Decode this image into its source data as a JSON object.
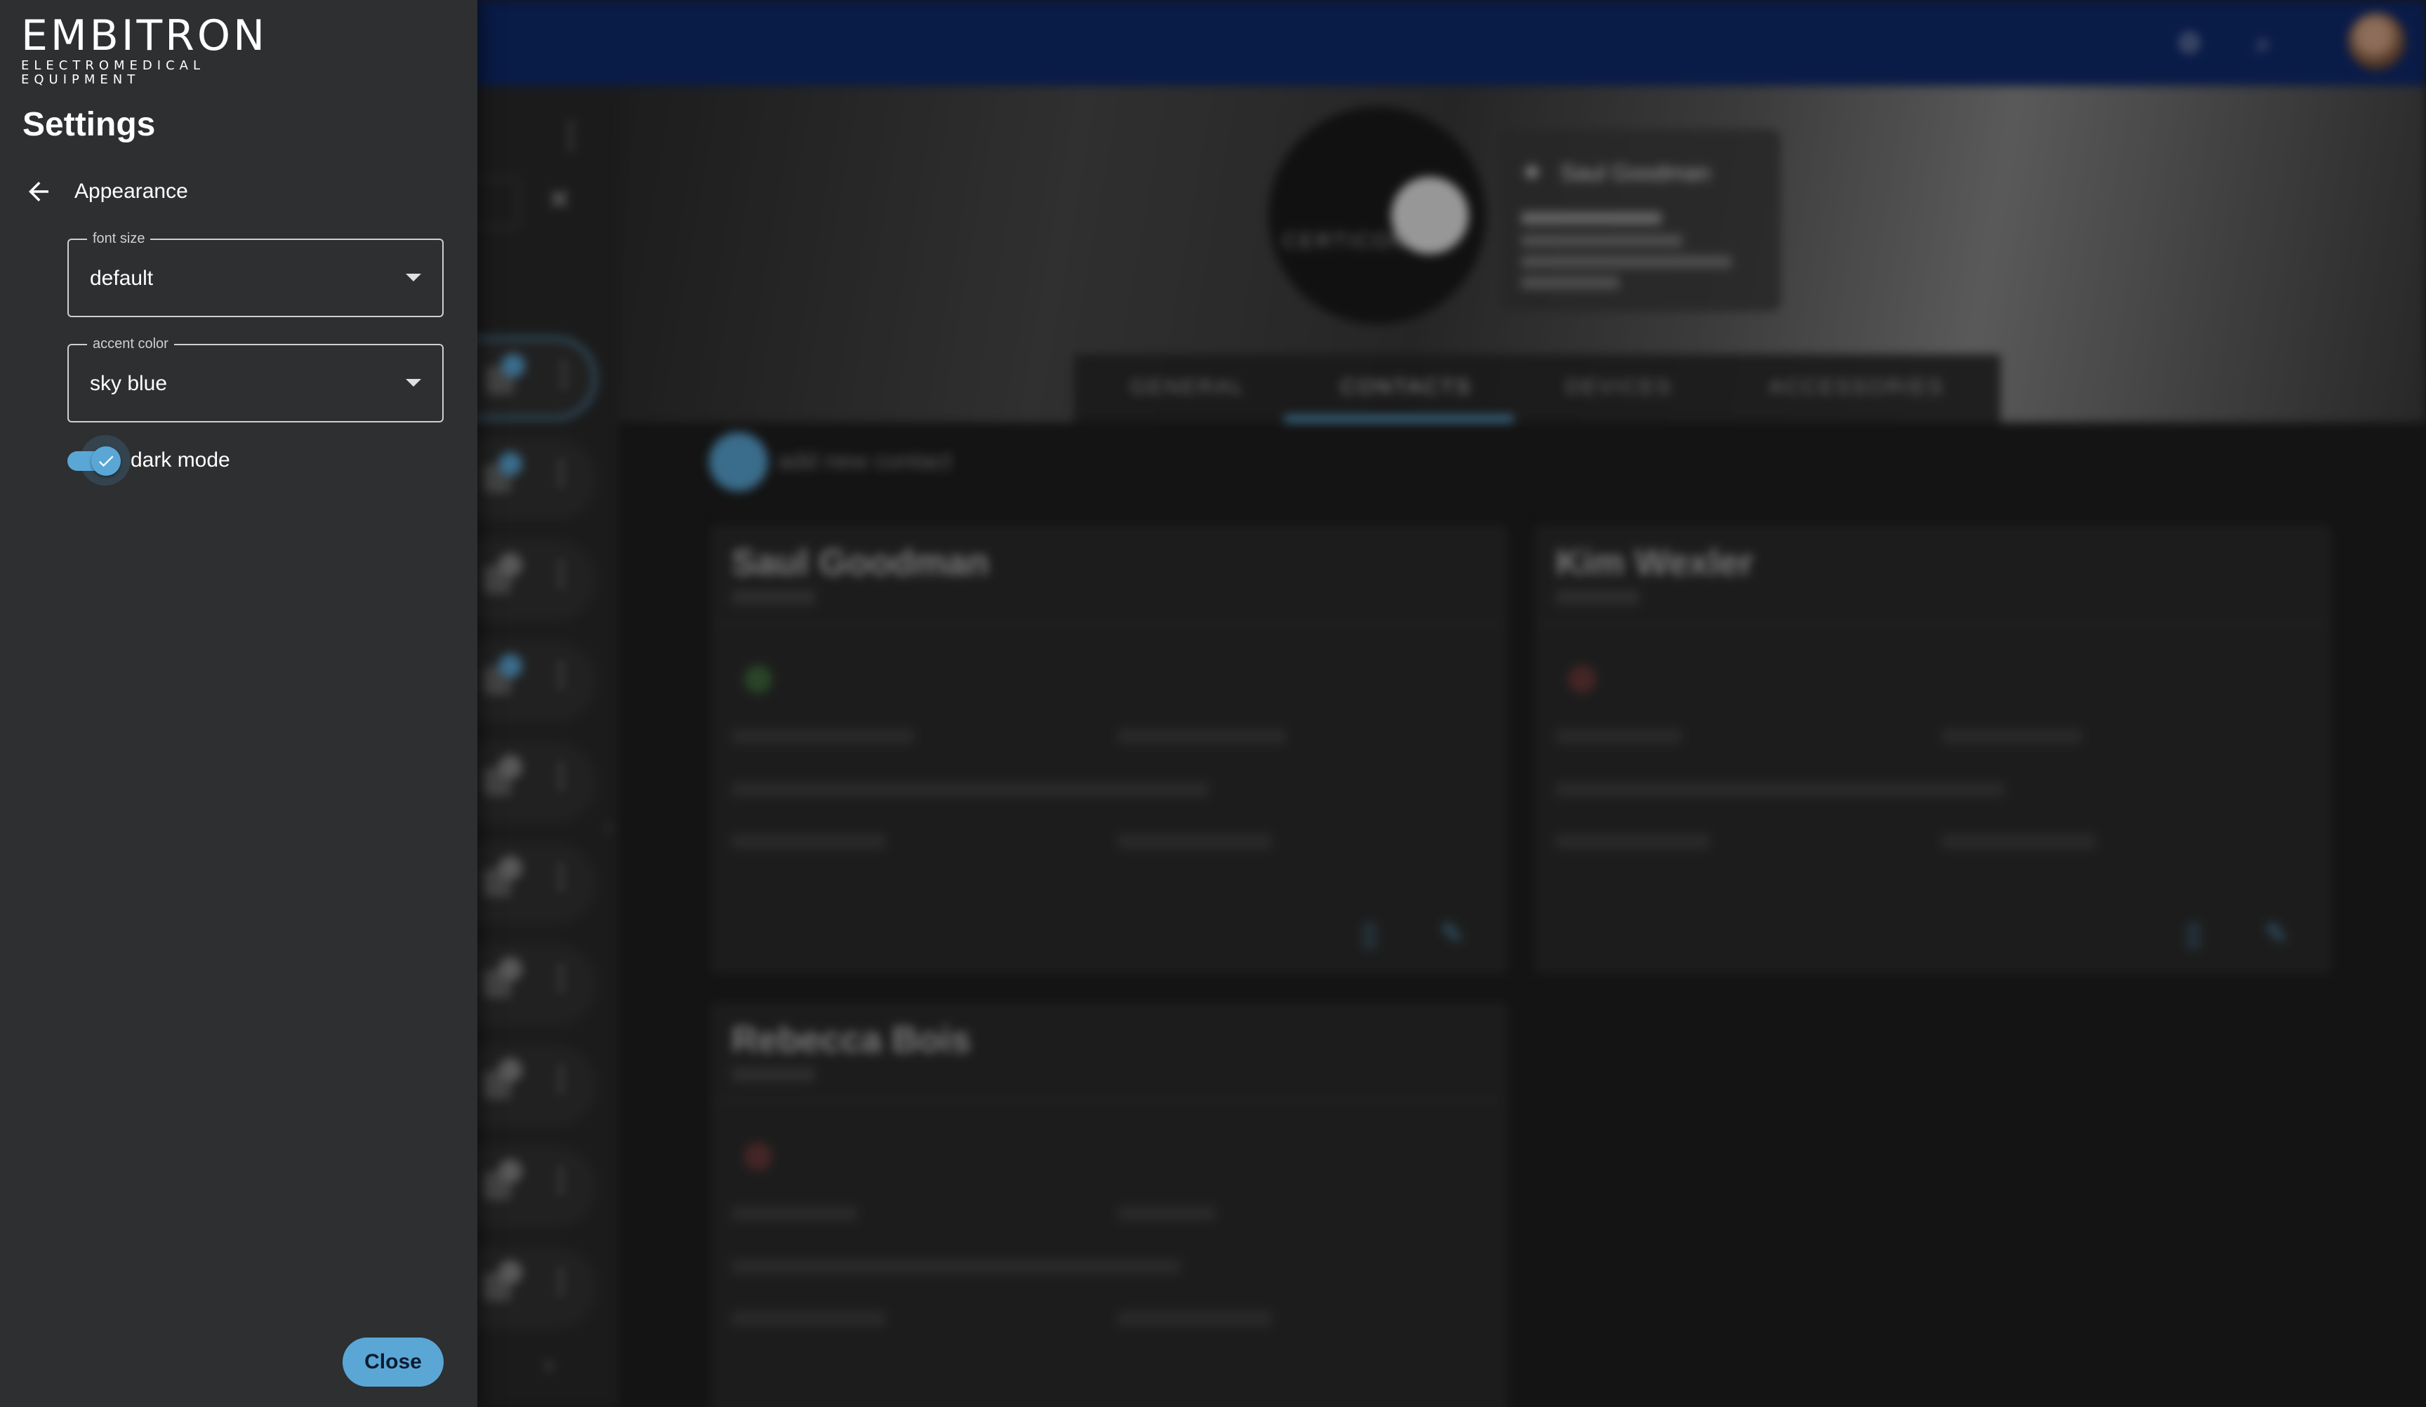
{
  "brand": {
    "name": "EMBITRON",
    "tagline": "ELECTROMEDICAL EQUIPMENT"
  },
  "settings": {
    "title": "Settings",
    "section": "Appearance",
    "font_size": {
      "label": "font size",
      "value": "default"
    },
    "accent_color": {
      "label": "accent color",
      "value": "sky blue"
    },
    "dark_mode": {
      "label": "dark mode",
      "enabled": true
    },
    "close_label": "Close"
  },
  "background": {
    "tabs": [
      "GENERAL",
      "CONTACTS",
      "DEVICES",
      "ACCESSORIES"
    ],
    "active_tab": "CONTACTS",
    "add_contact_label": "add new contact",
    "company_card": {
      "name": "Saul Goodman"
    },
    "contacts": [
      {
        "name": "Saul Goodman"
      },
      {
        "name": "Kim Wexler"
      },
      {
        "name": "Rebecca Bois"
      }
    ]
  },
  "colors": {
    "accent": "#5aa7d6",
    "drawer_bg": "#2d2f30",
    "topbar": "#0f2a6e"
  },
  "icons": {
    "back": "arrow-left-icon",
    "dropdown": "caret-down-icon",
    "toggle_check": "check-icon"
  }
}
